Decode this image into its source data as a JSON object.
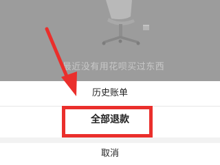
{
  "empty_state": {
    "illustration_icon": "office-chair-icon",
    "message": "最近没有用花呗买过东西"
  },
  "action_sheet": {
    "items": [
      {
        "label": "历史账单"
      },
      {
        "label": "全部退款"
      },
      {
        "label": "取消"
      }
    ]
  },
  "annotation": {
    "highlight_color": "#ea2f2c",
    "arrow_color": "#ea2f2c",
    "arrow_icon": "pointer-arrow-icon"
  }
}
